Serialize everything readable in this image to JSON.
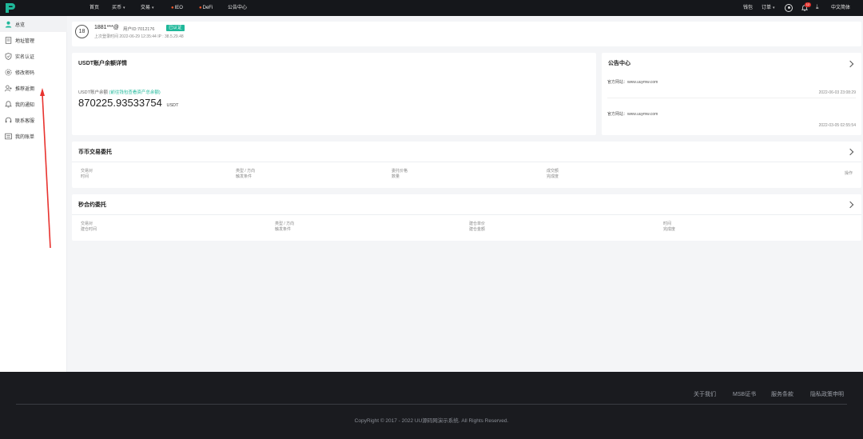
{
  "topnav": {
    "home": "首页",
    "buy": "买币",
    "trade": "交易",
    "ieo": "IEO",
    "defi": "DeFi",
    "announcements": "公告中心",
    "wallet": "钱包",
    "orders": "订单",
    "notification_count": "12",
    "language": "中文简体"
  },
  "sidebar": {
    "items": [
      {
        "label": "总览",
        "icon": "user-icon"
      },
      {
        "label": "地址管理",
        "icon": "document-icon"
      },
      {
        "label": "实名认证",
        "icon": "shield-icon"
      },
      {
        "label": "修改密码",
        "icon": "gear-icon"
      },
      {
        "label": "推荐返佣",
        "icon": "user-add-icon"
      },
      {
        "label": "我的通知",
        "icon": "bell-icon"
      },
      {
        "label": "联系客服",
        "icon": "headset-icon"
      },
      {
        "label": "我的账单",
        "icon": "bill-icon"
      }
    ]
  },
  "user": {
    "avatar_text": "18",
    "username": "1881***@",
    "user_id": "用户ID:7012176",
    "verified": "已认证",
    "last_login": "上次登录时间 2022-06-29 12:35:44   IP : 38.5.29.48"
  },
  "balance": {
    "title": "USDT账户余额详情",
    "label": "USDT账户余额",
    "link": "(前往钱包查看资产总余额)",
    "value": "870225.93533754",
    "unit": "USDT"
  },
  "notices": {
    "title": "公告中心",
    "items": [
      {
        "text": "官方网站：www.uuymw.com",
        "time": "2022-06-03 23:08:29"
      },
      {
        "text": "官方网站：www.uuymw.com",
        "time": "2022-03-05 02:55:54"
      }
    ]
  },
  "coin_orders": {
    "title": "币币交易委托",
    "cols": [
      {
        "top": "交易对",
        "bottom": "时间"
      },
      {
        "top": "类型 / 方向",
        "bottom": "触发条件"
      },
      {
        "top": "委托价格",
        "bottom": "数量"
      },
      {
        "top": "成交额",
        "bottom": "完成度"
      },
      {
        "top": "操作",
        "bottom": ""
      }
    ]
  },
  "second_orders": {
    "title": "秒合约委托",
    "cols": [
      {
        "top": "交易对",
        "bottom": "建仓时间"
      },
      {
        "top": "类型 / 方向",
        "bottom": "触发条件"
      },
      {
        "top": "建仓单价",
        "bottom": "建仓金额"
      },
      {
        "top": "时间",
        "bottom": "完成度"
      }
    ]
  },
  "footer": {
    "links": [
      "关于我们",
      "MSB证书",
      "服务条款",
      "隐私政策申明"
    ],
    "copyright": "CopyRight © 2017 - 2022 UU源码网演示系统. All Rights Reserved."
  },
  "colors": {
    "accent": "#1fb89a",
    "nav_bg": "#15171b",
    "footer_bg": "#1a1b1f",
    "annotation": "#e8332f"
  }
}
